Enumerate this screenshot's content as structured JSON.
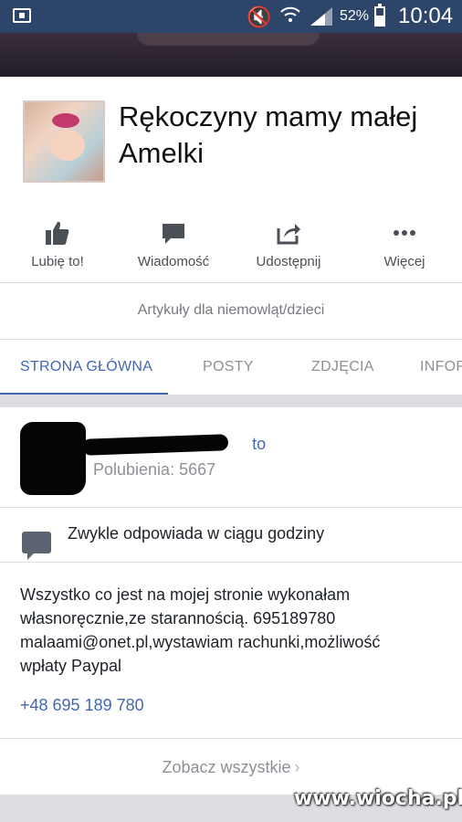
{
  "status_bar": {
    "battery_percent": "52%",
    "time": "10:04",
    "icons": [
      "screenshot-icon",
      "mute-icon",
      "wifi-icon",
      "signal-icon",
      "battery-icon"
    ]
  },
  "page": {
    "title": "Rękoczyny mamy małej Amelki",
    "category": "Artykuły dla niemowląt/dzieci"
  },
  "actions": [
    {
      "label": "Lubię to!",
      "icon": "thumbs-up-icon"
    },
    {
      "label": "Wiadomość",
      "icon": "message-icon"
    },
    {
      "label": "Udostępnij",
      "icon": "share-icon"
    },
    {
      "label": "Więcej",
      "icon": "more-icon"
    }
  ],
  "tabs": [
    {
      "label": "STRONA GŁÓWNA",
      "active": true
    },
    {
      "label": "POSTY",
      "active": false
    },
    {
      "label": "ZDJĘCIA",
      "active": false
    },
    {
      "label": "INFOR",
      "active": false
    }
  ],
  "liker": {
    "name": "to",
    "likes": "Polubienia: 5667"
  },
  "response": {
    "text": "Zwykle odpowiada w ciągu godziny"
  },
  "about": {
    "text": "Wszystko co jest na mojej stronie wykonałam własnoręcznie,ze starannością. 695189780 malaami@onet.pl,wystawiam rachunki,możliwość wpłaty Paypal",
    "phone": "+48 695 189 780"
  },
  "see_all": "Zobacz wszystkie",
  "watermark": "www.wiocha.pl",
  "colors": {
    "accent": "#4267b2",
    "status_bar": "#2d4569"
  }
}
